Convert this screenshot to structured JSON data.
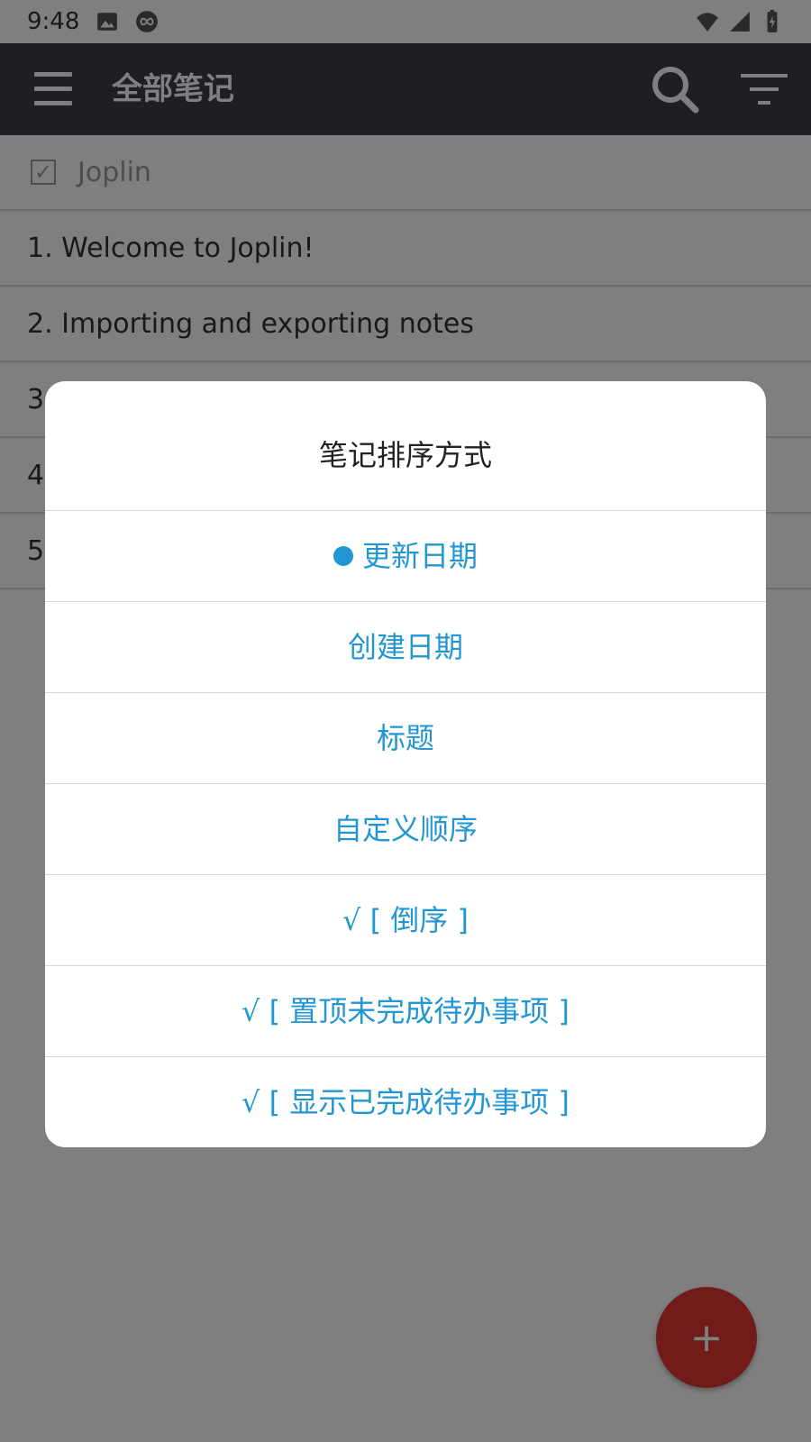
{
  "status_bar": {
    "time": "9:48",
    "icons": [
      "image-icon",
      "infinity-icon",
      "wifi-icon",
      "signal-icon",
      "battery-icon"
    ]
  },
  "app_bar": {
    "title": "全部笔记",
    "icons": [
      "menu-icon",
      "search-icon",
      "sort-icon"
    ]
  },
  "note_list": {
    "folder": "Joplin",
    "notes": [
      "1. Welcome to Joplin!",
      "2. Importing and exporting notes",
      "3",
      "4",
      "5"
    ]
  },
  "fab": {
    "label": "+"
  },
  "sort_dialog": {
    "title": "笔记排序方式",
    "options": [
      "更新日期",
      "创建日期",
      "标题",
      "自定义顺序",
      "√ [ 倒序 ]",
      "√ [ 置顶未完成待办事项 ]",
      "√ [ 显示已完成待办事项 ]"
    ]
  },
  "colors": {
    "app_bar": "#3a3f4b",
    "accent": "#2196d3",
    "fab": "#e53935"
  }
}
